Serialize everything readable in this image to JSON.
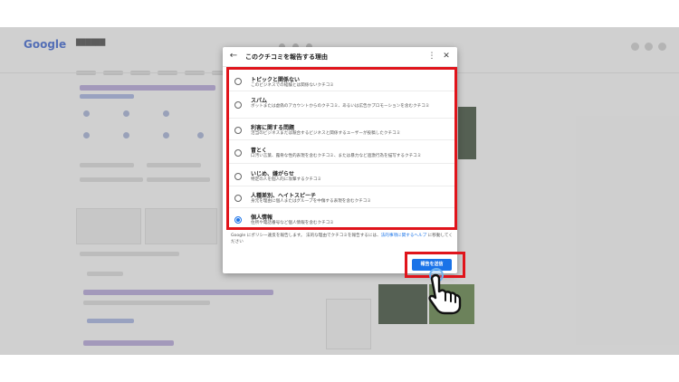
{
  "background": {
    "logo": "Google",
    "query": "██████"
  },
  "dialog": {
    "title": "このクチコミを報告する理由",
    "options": [
      {
        "title": "トピックと関係ない",
        "desc": "このビジネスでの経験とは関係ないクチコミ",
        "selected": false
      },
      {
        "title": "スパム",
        "desc": "ボットまたは虚偽のアカウントからのクチコミ、あるいは広告かプロモーションを含むクチコミ",
        "selected": false
      },
      {
        "title": "利害に関する問題",
        "desc": "活当のビジネスまたは競合するビジネスと関係するユーザーが投稿したクチコミ",
        "selected": false
      },
      {
        "title": "冒とく",
        "desc": "口汚い言葉、露骨な性的表現を含むクチコミ、または暴力など過激行為を描写するクチコミ",
        "selected": false
      },
      {
        "title": "いじめ、嫌がらせ",
        "desc": "特定の人を個人的に攻撃するクチコミ",
        "selected": false
      },
      {
        "title": "人種差別、ヘイトスピーチ",
        "desc": "身元を理由に個人またはグループを中傷する表現を含むクチコミ",
        "selected": false
      },
      {
        "title": "個人情報",
        "desc": "住所や電話番号など個人情報を含むクチコミ",
        "selected": true
      }
    ],
    "policy_pre": "Google にポリシー違反を報告します。 法的な理由でクチコミを報告するには、",
    "policy_link": "法的事項に関するヘルプ",
    "policy_post": " に移動してください",
    "submit_label": "報告を送信"
  },
  "colors": {
    "accent": "#1a73e8",
    "highlight": "#e0141b"
  }
}
